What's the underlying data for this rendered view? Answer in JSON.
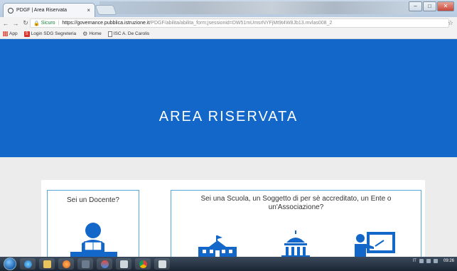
{
  "browser": {
    "tab_title": "PDGF | Area Riservata",
    "tab_close": "×",
    "address": {
      "secure_label": "Sicuro",
      "url_host": "https://governance.pubblica.istruzione.it",
      "url_path": "/PDGF/abilita/abilita_form;jsessionid=DW51mUmsrNYFjMt9t4W8Jb13.mvlas008_2"
    },
    "bookmarks": [
      {
        "label": "App",
        "icon": "apps-icon"
      },
      {
        "label": "Login SDG Segreteria",
        "icon": "sdg-icon"
      },
      {
        "label": "Home",
        "icon": "gear-icon"
      },
      {
        "label": "ISC A. De Carolis",
        "icon": "page-icon"
      }
    ],
    "sdg_icon_letter": "S"
  },
  "page": {
    "hero_title": "AREA RISERVATA",
    "hero_color": "#1267c9",
    "panel_docente": {
      "title": "Sei un Docente?"
    },
    "panel_scuola": {
      "title": "Sei una Scuola, un Soggetto di per sè accreditato, un Ente o un'Associazione?"
    },
    "accent_color": "#56a7dc",
    "icon_color": "#1267c9"
  },
  "taskbar": {
    "apps": [
      "explorer",
      "folder",
      "media-player",
      "media-center",
      "paint",
      "calculator",
      "chrome",
      "recorder"
    ],
    "tray": {
      "lang": "IT",
      "clock": "09:26"
    }
  }
}
